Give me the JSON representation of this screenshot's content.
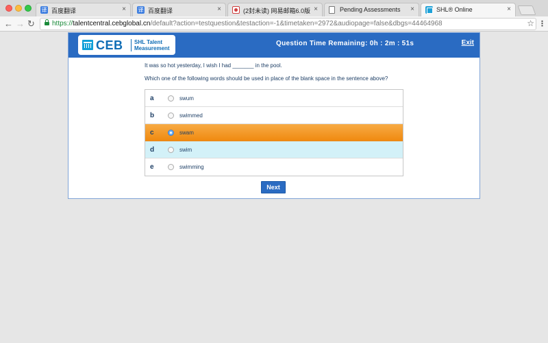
{
  "browser": {
    "tabs": [
      {
        "title": "百度翻译",
        "active": false,
        "favicon": "fanyi-icon"
      },
      {
        "title": "百度翻译",
        "active": false,
        "favicon": "fanyi-icon"
      },
      {
        "title": "(2封未读) 网易邮箱6.0版",
        "active": false,
        "favicon": "mail-icon"
      },
      {
        "title": "Pending Assessments",
        "active": false,
        "favicon": "document-icon"
      },
      {
        "title": "SHL® Online",
        "active": true,
        "favicon": "shl-icon"
      }
    ],
    "close_glyph": "×",
    "url": {
      "scheme": "https://",
      "host": "talentcentral.cebglobal.cn",
      "path": "/default?action=testquestion&testaction=-1&timetaken=2972&audiopage=false&dbgs=44464968"
    },
    "nav": {
      "back": "←",
      "forward": "→",
      "reload": "↻",
      "star": "☆",
      "menu": "⋮"
    }
  },
  "app": {
    "logo": {
      "brand": "CEB",
      "product_line1": "SHL Talent",
      "product_line2": "Measurement"
    },
    "timer_text": "Question Time Remaining: 0h : 2m : 51s",
    "exit_label": "Exit",
    "question_text": "It was so hot yesterday, I wish I had _______ in the pool.",
    "prompt_text": "Which one of the following words should be used in place of the blank space in the sentence above?",
    "options": [
      {
        "letter": "a",
        "text": "swum",
        "selected": false
      },
      {
        "letter": "b",
        "text": "swimmed",
        "selected": false
      },
      {
        "letter": "c",
        "text": "swam",
        "selected": true
      },
      {
        "letter": "d",
        "text": "swim",
        "selected": false
      },
      {
        "letter": "e",
        "text": "swimming",
        "selected": false
      }
    ],
    "next_label": "Next"
  },
  "colors": {
    "header_blue": "#2a6bc2",
    "selected_orange": "#f39a25",
    "hover_cyan": "#d3f1f8",
    "text_navy": "#1e3f66"
  }
}
